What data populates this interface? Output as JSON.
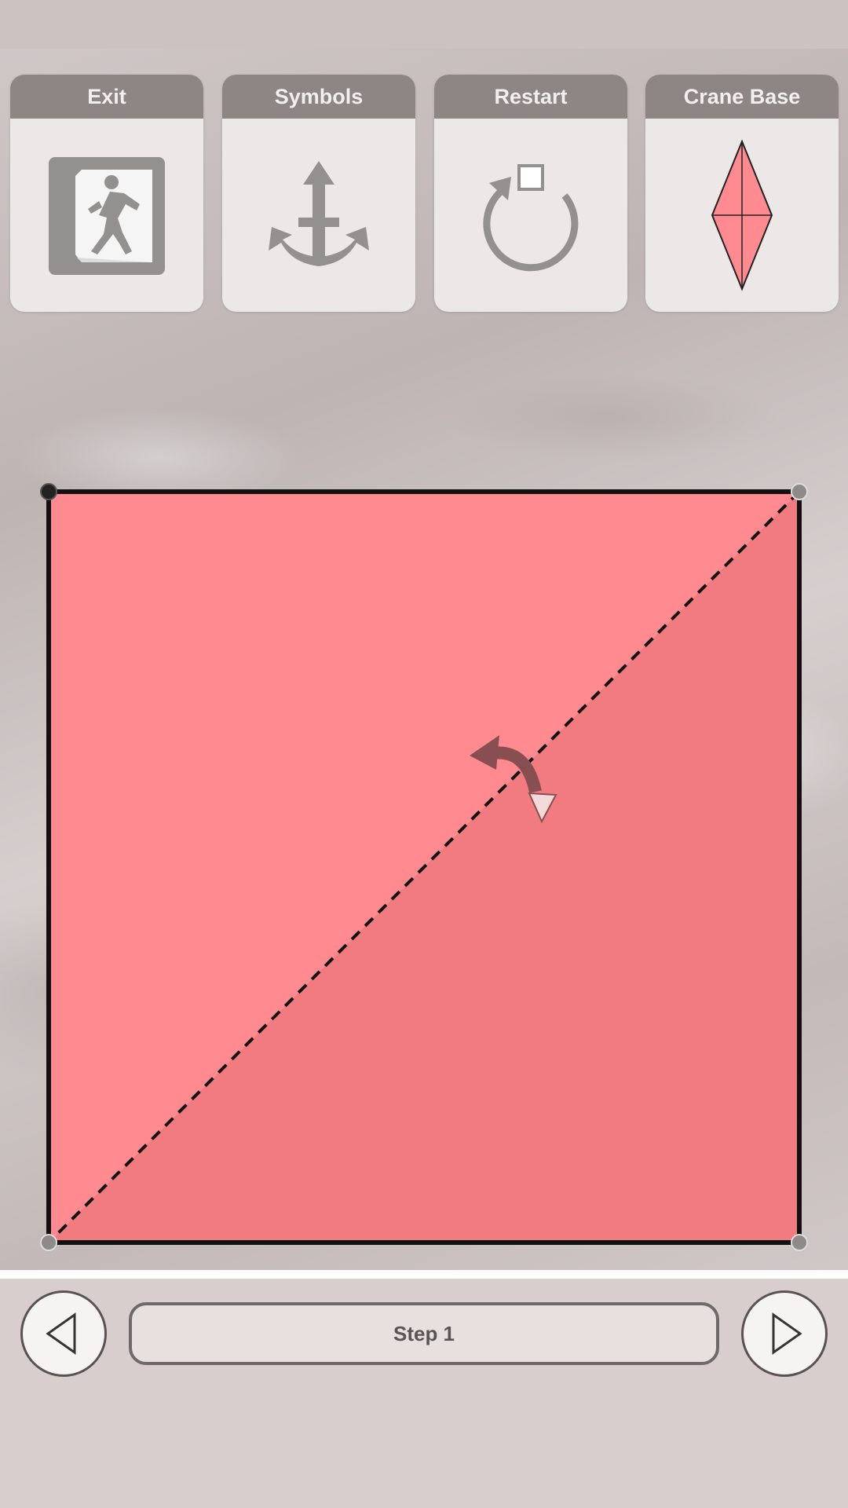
{
  "toolbar": {
    "exit_label": "Exit",
    "symbols_label": "Symbols",
    "restart_label": "Restart",
    "crane_base_label": "Crane Base"
  },
  "navigation": {
    "step_label": "Step 1"
  },
  "colors": {
    "paper_light": "#ff8a8f",
    "paper_dark": "#f27b80",
    "icon_gray": "#939090",
    "toolbar_header": "#8e8685",
    "fold_arrow": "#874f51"
  },
  "icons": {
    "exit": "exit-door-icon",
    "symbols": "anchor-icon",
    "restart": "restart-icon",
    "crane_base": "crane-base-icon",
    "prev": "triangle-left-icon",
    "next": "triangle-right-icon"
  }
}
